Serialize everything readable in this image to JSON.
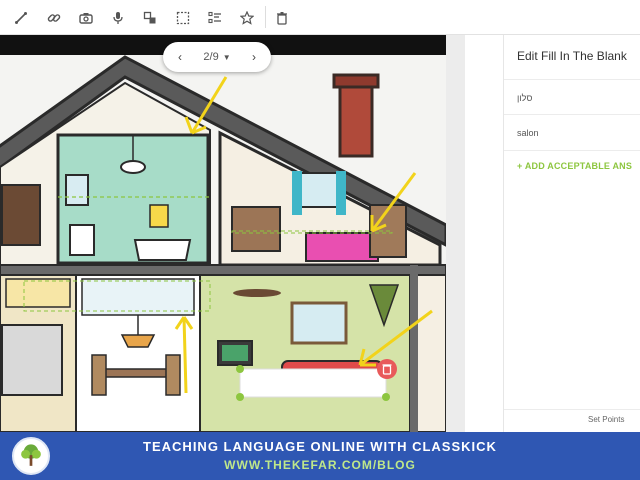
{
  "toolbar": {
    "tools": [
      "line-icon",
      "link-icon",
      "camera-icon",
      "microphone-icon",
      "shapes-icon",
      "select-box-icon",
      "list-icon",
      "star-icon",
      "trash-icon"
    ]
  },
  "canvas": {
    "pager": {
      "current": "2/9"
    }
  },
  "panel": {
    "title": "Edit Fill In The Blank",
    "answers": [
      "סלון",
      "salon"
    ],
    "add_answer": "+ ADD ACCEPTABLE ANS",
    "set_points": "Set Points"
  },
  "banner": {
    "title": "TEACHING LANGUAGE ONLINE WITH CLASSKICK",
    "url": "WWW.THEKEFAR.COM/BLOG"
  },
  "colors": {
    "accent_green": "#8dc63f",
    "banner_blue": "#2f57b3",
    "annotation_yellow": "#f2d31b",
    "delete_red": "#e85a5a"
  }
}
